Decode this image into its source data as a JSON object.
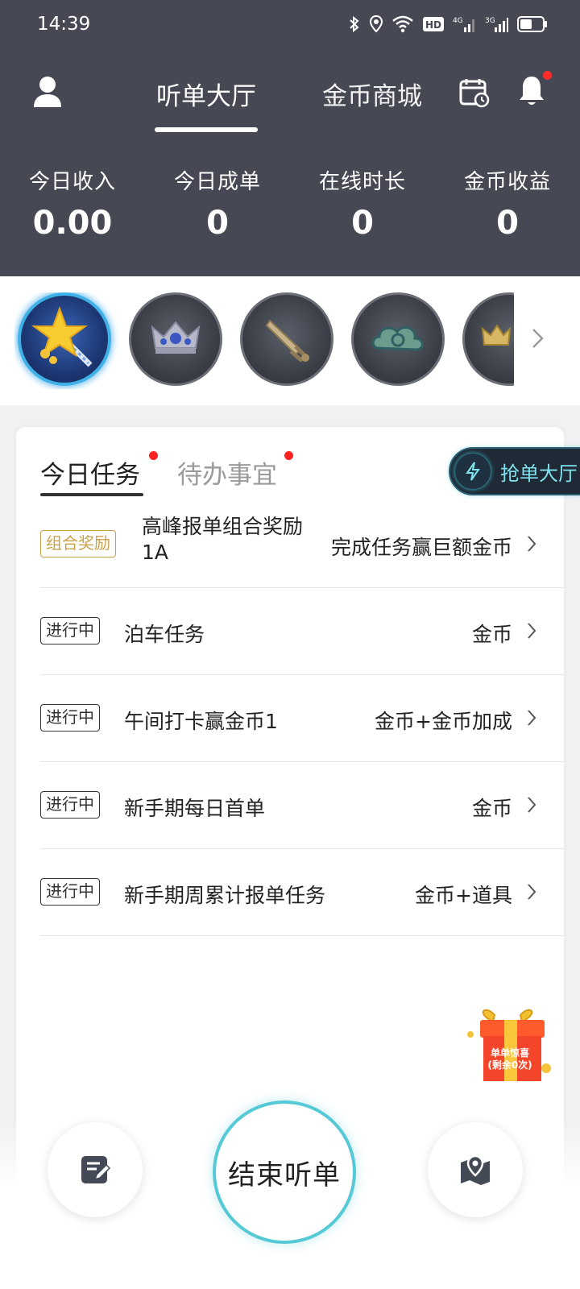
{
  "status_bar": {
    "time": "14:39",
    "icons": [
      "bluetooth-icon",
      "location-icon",
      "wifi-icon",
      "hd-icon",
      "signal-4g-icon",
      "signal-3g-icon",
      "battery-icon"
    ]
  },
  "nav": {
    "tabs": [
      {
        "label": "听单大厅",
        "active": true
      },
      {
        "label": "金币商城",
        "active": false
      }
    ],
    "icons": [
      "user-icon",
      "calendar-icon",
      "bell-icon"
    ]
  },
  "stats": [
    {
      "label": "今日收入",
      "value": "0.00"
    },
    {
      "label": "今日成单",
      "value": "0"
    },
    {
      "label": "在线时长",
      "value": "0"
    },
    {
      "label": "金币收益",
      "value": "0"
    }
  ],
  "badges": [
    {
      "icon": "magic-wand-star-icon",
      "active": true
    },
    {
      "icon": "crown-icon",
      "active": false
    },
    {
      "icon": "sword-icon",
      "active": false
    },
    {
      "icon": "cloud-icon",
      "active": false
    },
    {
      "icon": "gold-crown-icon",
      "active": false
    }
  ],
  "task_card": {
    "tabs": [
      {
        "label": "今日任务",
        "active": true,
        "dot": true
      },
      {
        "label": "待办事宜",
        "active": false,
        "dot": true
      }
    ],
    "grab_hall_label": "抢单大厅",
    "tasks": [
      {
        "tag": "组合奖励",
        "title": "高峰报单组合奖励1A",
        "reward": "完成任务赢巨额金币"
      },
      {
        "tag": "进行中",
        "title": "泊车任务",
        "reward": "金币"
      },
      {
        "tag": "进行中",
        "title": "午间打卡赢金币1",
        "reward": "金币+金币加成"
      },
      {
        "tag": "进行中",
        "title": "新手期每日首单",
        "reward": "金币"
      },
      {
        "tag": "进行中",
        "title": "新手期周累计报单任务",
        "reward": "金币+道具"
      }
    ]
  },
  "gift": {
    "line1": "单单惊喜",
    "line2": "(剩余0次)"
  },
  "bottom": {
    "end_label": "结束听单"
  },
  "colors": {
    "header_bg": "#464953",
    "accent_cyan": "#56c9d6",
    "tag_gold": "#c9a24a",
    "dot_red": "#ff2222"
  }
}
